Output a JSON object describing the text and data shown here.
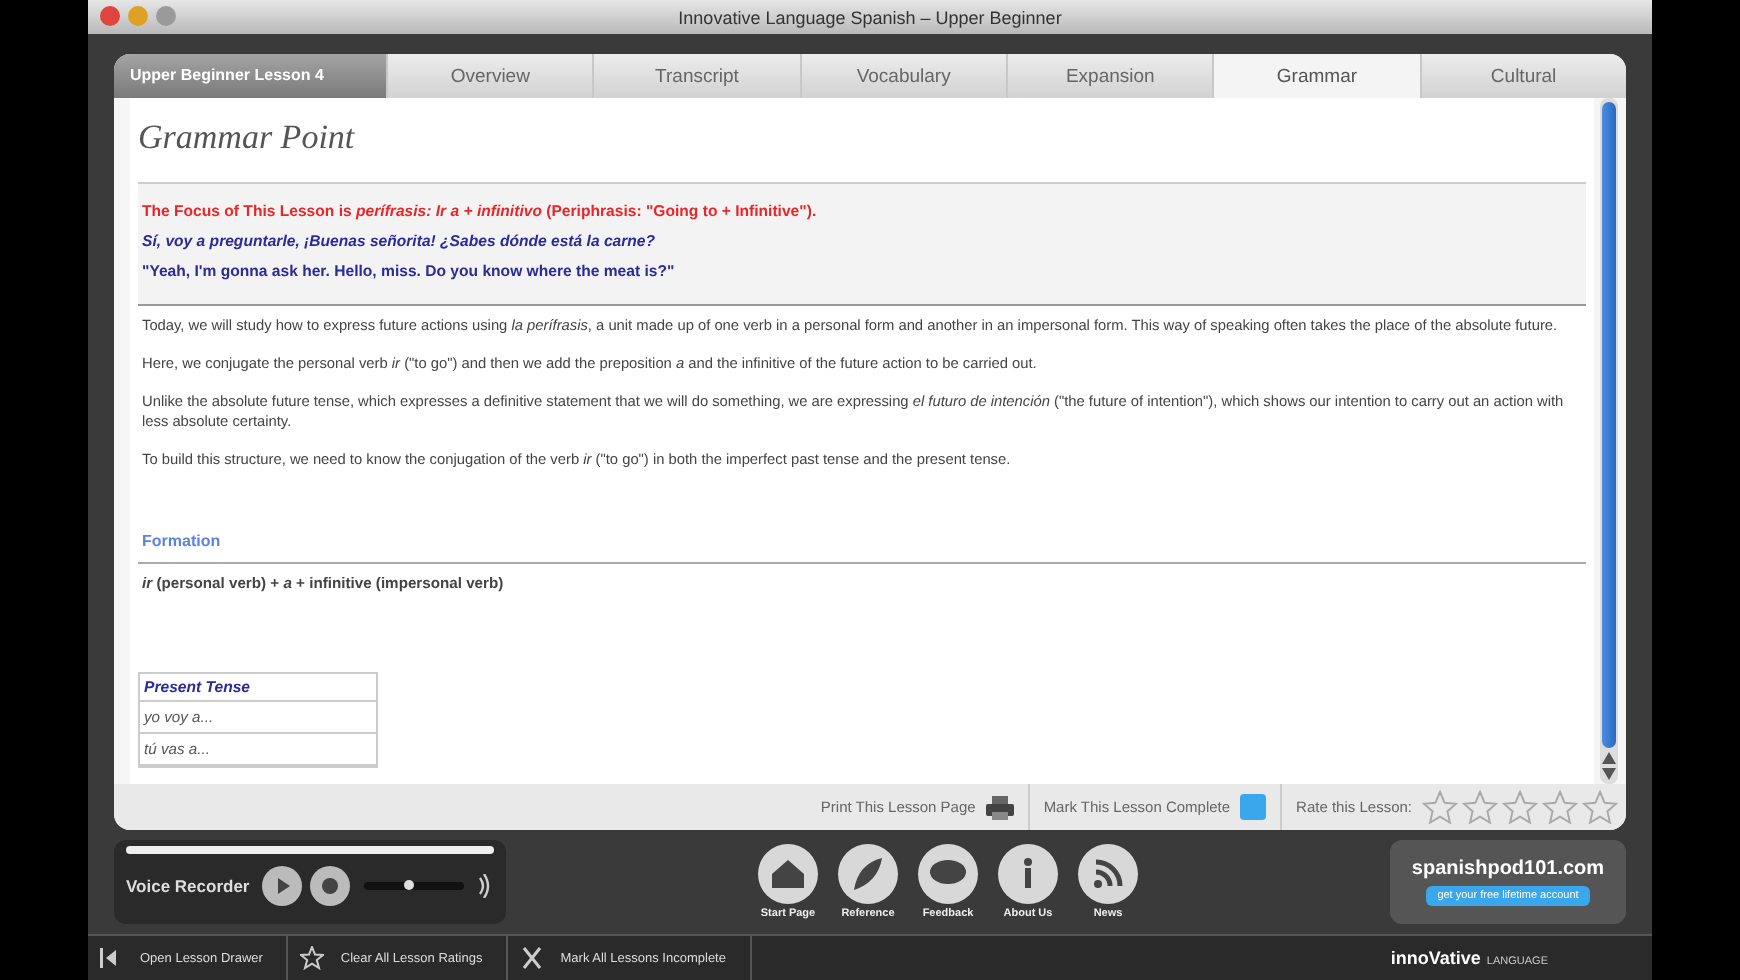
{
  "window": {
    "title": "Innovative Language Spanish – Upper Beginner"
  },
  "lesson_label": "Upper Beginner Lesson 4",
  "tabs": [
    {
      "label": "Overview",
      "selected": false
    },
    {
      "label": "Transcript",
      "selected": false
    },
    {
      "label": "Vocabulary",
      "selected": false
    },
    {
      "label": "Expansion",
      "selected": false
    },
    {
      "label": "Grammar",
      "selected": true
    },
    {
      "label": "Cultural",
      "selected": false
    }
  ],
  "page_title": "Grammar Point",
  "focus": [
    "The Focus of This Lesson is *perífrasis: Ir a + infinitivo* (Periphrasis: \"Going to + Infinitive\").",
    "Sí, voy a preguntarle, ¡Buenas señorita! ¿Sabes dónde está la carne?",
    "\"Yeah, I'm gonna ask her. Hello, miss. Do you know where the meat is?\""
  ],
  "paragraphs": [
    "Today, we will study how to express future actions using *la perífrasis*, a unit made up of one verb in a personal form and another in an impersonal form. This way of speaking often takes the place of the absolute future.",
    "Here, we conjugate the personal verb *ir* (\"to go\") and then we add the preposition *a* and the infinitive of the future action to be carried out.",
    "Unlike the absolute future tense, which expresses a definitive statement that we will do something, we are expressing *el futuro de intención* (\"the future of intention\"), which shows our intention to carry out an action with less absolute certainty.",
    "To build this structure, we need to know the conjugation of the verb *ir* (\"to go\") in both the imperfect past tense and the present tense."
  ],
  "formation": {
    "heading": "Formation",
    "formula": "*ir* (personal verb) + *a* + infinitive (impersonal verb)"
  },
  "table": {
    "header": "Present Tense",
    "rows": [
      "yo voy a...",
      "tú vas a..."
    ]
  },
  "footer": {
    "print": "Print This Lesson Page",
    "complete": "Mark This Lesson Complete",
    "checked": false,
    "rate": "Rate this Lesson:",
    "stars": 0
  },
  "recorder": {
    "label": "Voice Recorder",
    "level": 0.45
  },
  "nav": [
    "Start Page",
    "Reference",
    "Feedback",
    "About Us",
    "News"
  ],
  "brand": {
    "site": "spanishpod101.com",
    "cta": "get your free lifetime account",
    "maker": "innoVative",
    "maker_sub": "LANGUAGE"
  },
  "bottom": [
    "Open Lesson Drawer",
    "Clear All Lesson Ratings",
    "Mark All Lessons Incomplete"
  ]
}
